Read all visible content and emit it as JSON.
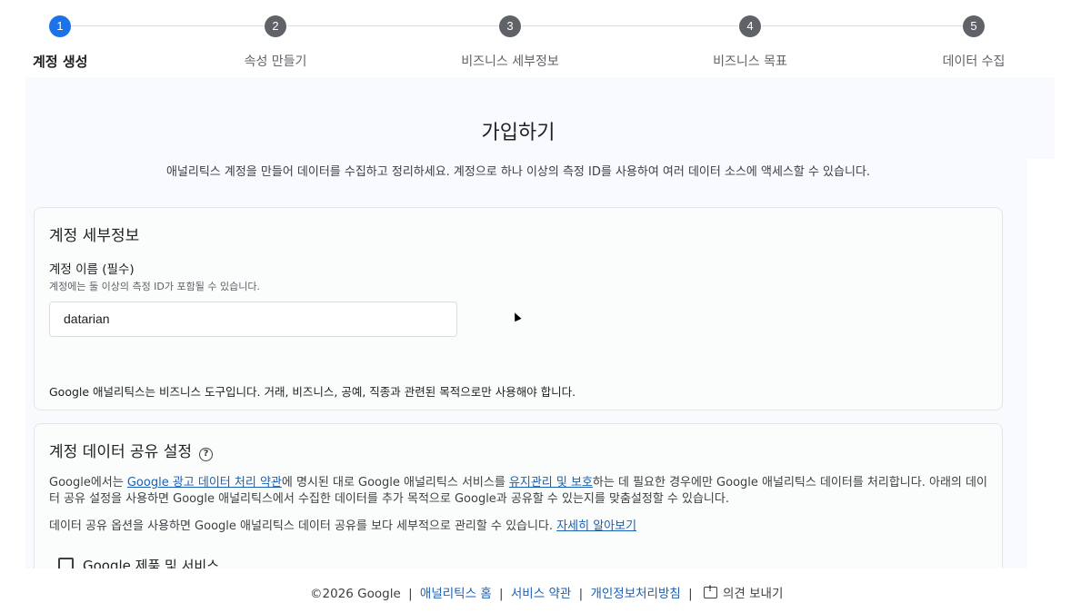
{
  "stepper": {
    "steps": [
      {
        "number": "1",
        "label": "계정 생성",
        "active": true
      },
      {
        "number": "2",
        "label": "속성 만들기",
        "active": false
      },
      {
        "number": "3",
        "label": "비즈니스 세부정보",
        "active": false
      },
      {
        "number": "4",
        "label": "비즈니스 목표",
        "active": false
      },
      {
        "number": "5",
        "label": "데이터 수집",
        "active": false
      }
    ]
  },
  "header": {
    "title": "가입하기",
    "subtitle": "애널리틱스 계정을 만들어 데이터를 수집하고 정리하세요. 계정으로 하나 이상의 측정 ID를 사용하여 여러 데이터 소스에 액세스할 수 있습니다."
  },
  "account_details": {
    "title": "계정 세부정보",
    "field_label": "계정 이름 (필수)",
    "field_help": "계정에는 둘 이상의 측정 ID가 포함될 수 있습니다.",
    "field_value": "datarian",
    "notice": "Google 애널리틱스는 비즈니스 도구입니다. 거래, 비즈니스, 공예, 직종과 관련된 목적으로만 사용해야 합니다."
  },
  "data_sharing": {
    "title": "계정 데이터 공유 설정",
    "help_icon": "help-circle-icon",
    "para1_a": "Google에서는 ",
    "para1_link1": "Google 광고 데이터 처리 약관",
    "para1_b": "에 명시된 대로 Google 애널리틱스 서비스를 ",
    "para1_link2": "유지관리 및 보호",
    "para1_c": "하는 데 필요한 경우에만 Google 애널리틱스 데이터를 처리합니다. 아래의 데이터 공유 설정을 사용하면 Google 애널리틱스에서 수집한 데이터를 추가 목적으로 Google과 공유할 수 있는지를 맞춤설정할 수 있습니다.",
    "para2_a": "데이터 공유 옵션을 사용하면 Google 애널리틱스 데이터 공유를 보다 세부적으로 관리할 수 있습니다. ",
    "para2_link": "자세히 알아보기",
    "checkbox_label": "Google 제품 및 서비스"
  },
  "footer": {
    "copyright": "©2026 Google",
    "sep": "|",
    "link_home": "애널리틱스 홈",
    "link_terms": "서비스 약관",
    "link_privacy": "개인정보처리방침",
    "feedback_icon": "feedback-icon",
    "feedback": "의견 보내기"
  },
  "colors": {
    "accent": "#1a73e8",
    "inactive_step": "#5f6368",
    "link": "#1a5fb4"
  }
}
